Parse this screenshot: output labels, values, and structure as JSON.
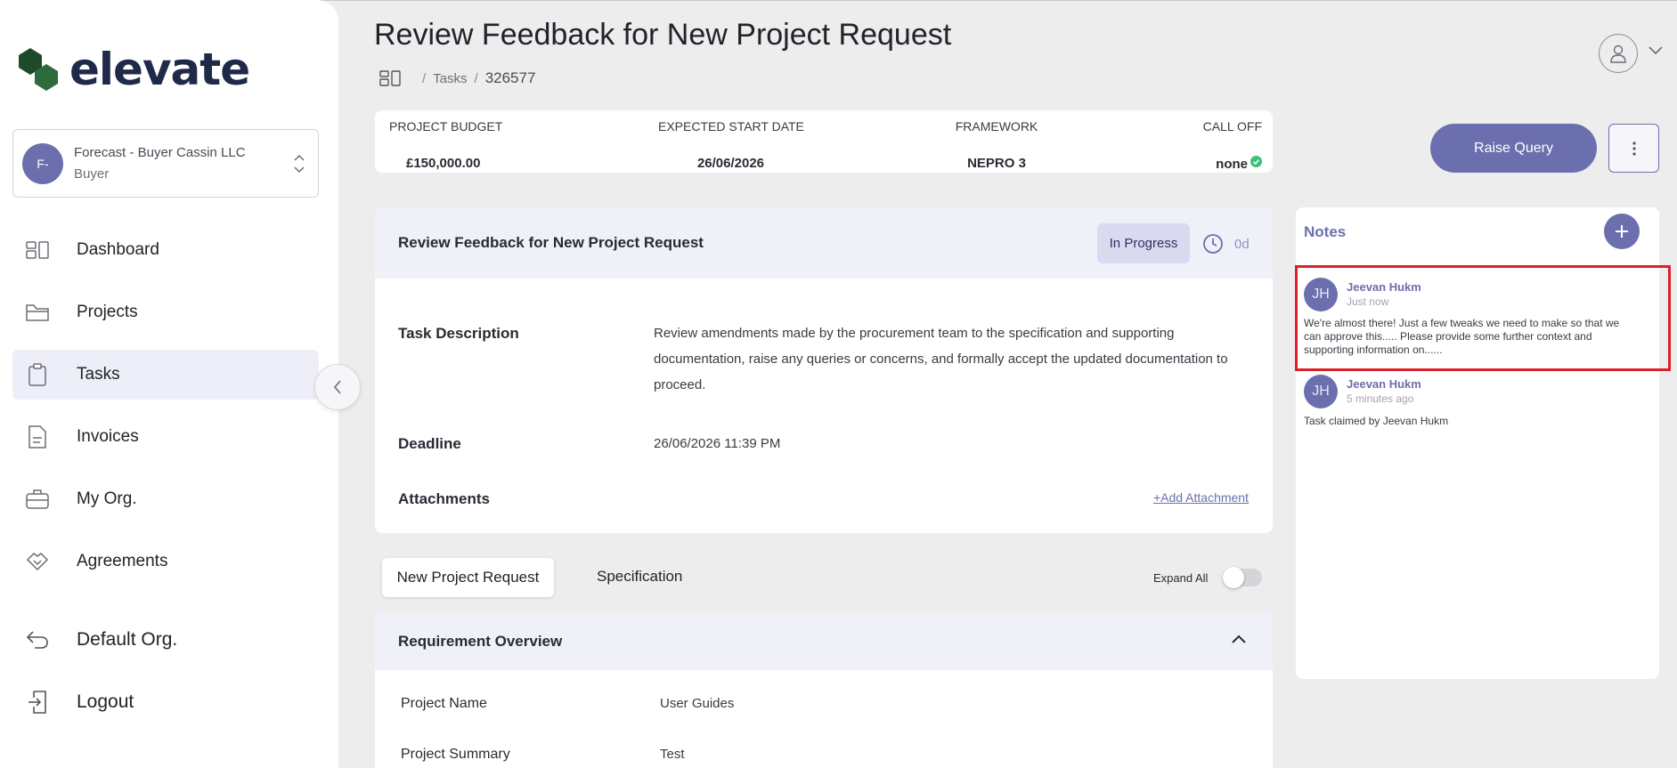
{
  "brand": {
    "name": "elevate",
    "color": "#1f4a2a"
  },
  "colors": {
    "accent": "#6b6fad",
    "highlight": "#dd1f2a",
    "success": "#3cc07a",
    "background": "#ededee"
  },
  "org_switcher": {
    "initials": "F-",
    "name": "Forecast - Buyer Cassin LLC",
    "role": "Buyer"
  },
  "nav": {
    "items": [
      {
        "label": "Dashboard",
        "icon": "dashboard-icon"
      },
      {
        "label": "Projects",
        "icon": "folder-icon"
      },
      {
        "label": "Tasks",
        "icon": "clipboard-icon",
        "active": true
      },
      {
        "label": "Invoices",
        "icon": "document-icon"
      },
      {
        "label": "My Org.",
        "icon": "briefcase-icon"
      },
      {
        "label": "Agreements",
        "icon": "handshake-icon"
      }
    ],
    "bottom": [
      {
        "label": "Default Org.",
        "icon": "return-arrow-icon"
      },
      {
        "label": "Logout",
        "icon": "logout-icon"
      }
    ]
  },
  "header": {
    "title": "Review Feedback for New Project Request",
    "breadcrumb": {
      "sep": "/",
      "tasks": "Tasks",
      "id": "326577"
    }
  },
  "info": {
    "budget_label": "PROJECT BUDGET",
    "budget_value": "£150,000.00",
    "start_label": "EXPECTED START DATE",
    "start_value": "26/06/2026",
    "framework_label": "FRAMEWORK",
    "framework_value": "NEPRO 3",
    "calloff_label": "CALL OFF",
    "calloff_value": "none"
  },
  "actions": {
    "raise_query": "Raise Query"
  },
  "task": {
    "title": "Review Feedback for New Project Request",
    "status": "In Progress",
    "days": "0d",
    "description_label": "Task Description",
    "description": "Review amendments made by the procurement team to the specification and supporting documentation, raise any queries or concerns, and formally accept the updated documentation to proceed.",
    "deadline_label": "Deadline",
    "deadline": "26/06/2026 11:39 PM",
    "attachments_label": "Attachments",
    "add_attachment": "+Add Attachment"
  },
  "tabs": [
    {
      "label": "New Project Request",
      "active": true
    },
    {
      "label": "Specification",
      "active": false
    }
  ],
  "expand_all": {
    "label": "Expand All",
    "on": false
  },
  "requirement": {
    "title": "Requirement Overview",
    "rows": [
      {
        "label": "Project Name",
        "value": "User Guides"
      },
      {
        "label": "Project Summary",
        "value": "Test"
      }
    ]
  },
  "notes": {
    "title": "Notes",
    "items": [
      {
        "initials": "JH",
        "author": "Jeevan Hukm",
        "time": "Just now",
        "text": "We're almost there! Just a few tweaks we need to make so that we can approve this..... Please provide some further context and supporting information on......"
      },
      {
        "initials": "JH",
        "author": "Jeevan Hukm",
        "time": "5 minutes ago",
        "text": "Task claimed by Jeevan Hukm"
      }
    ]
  }
}
